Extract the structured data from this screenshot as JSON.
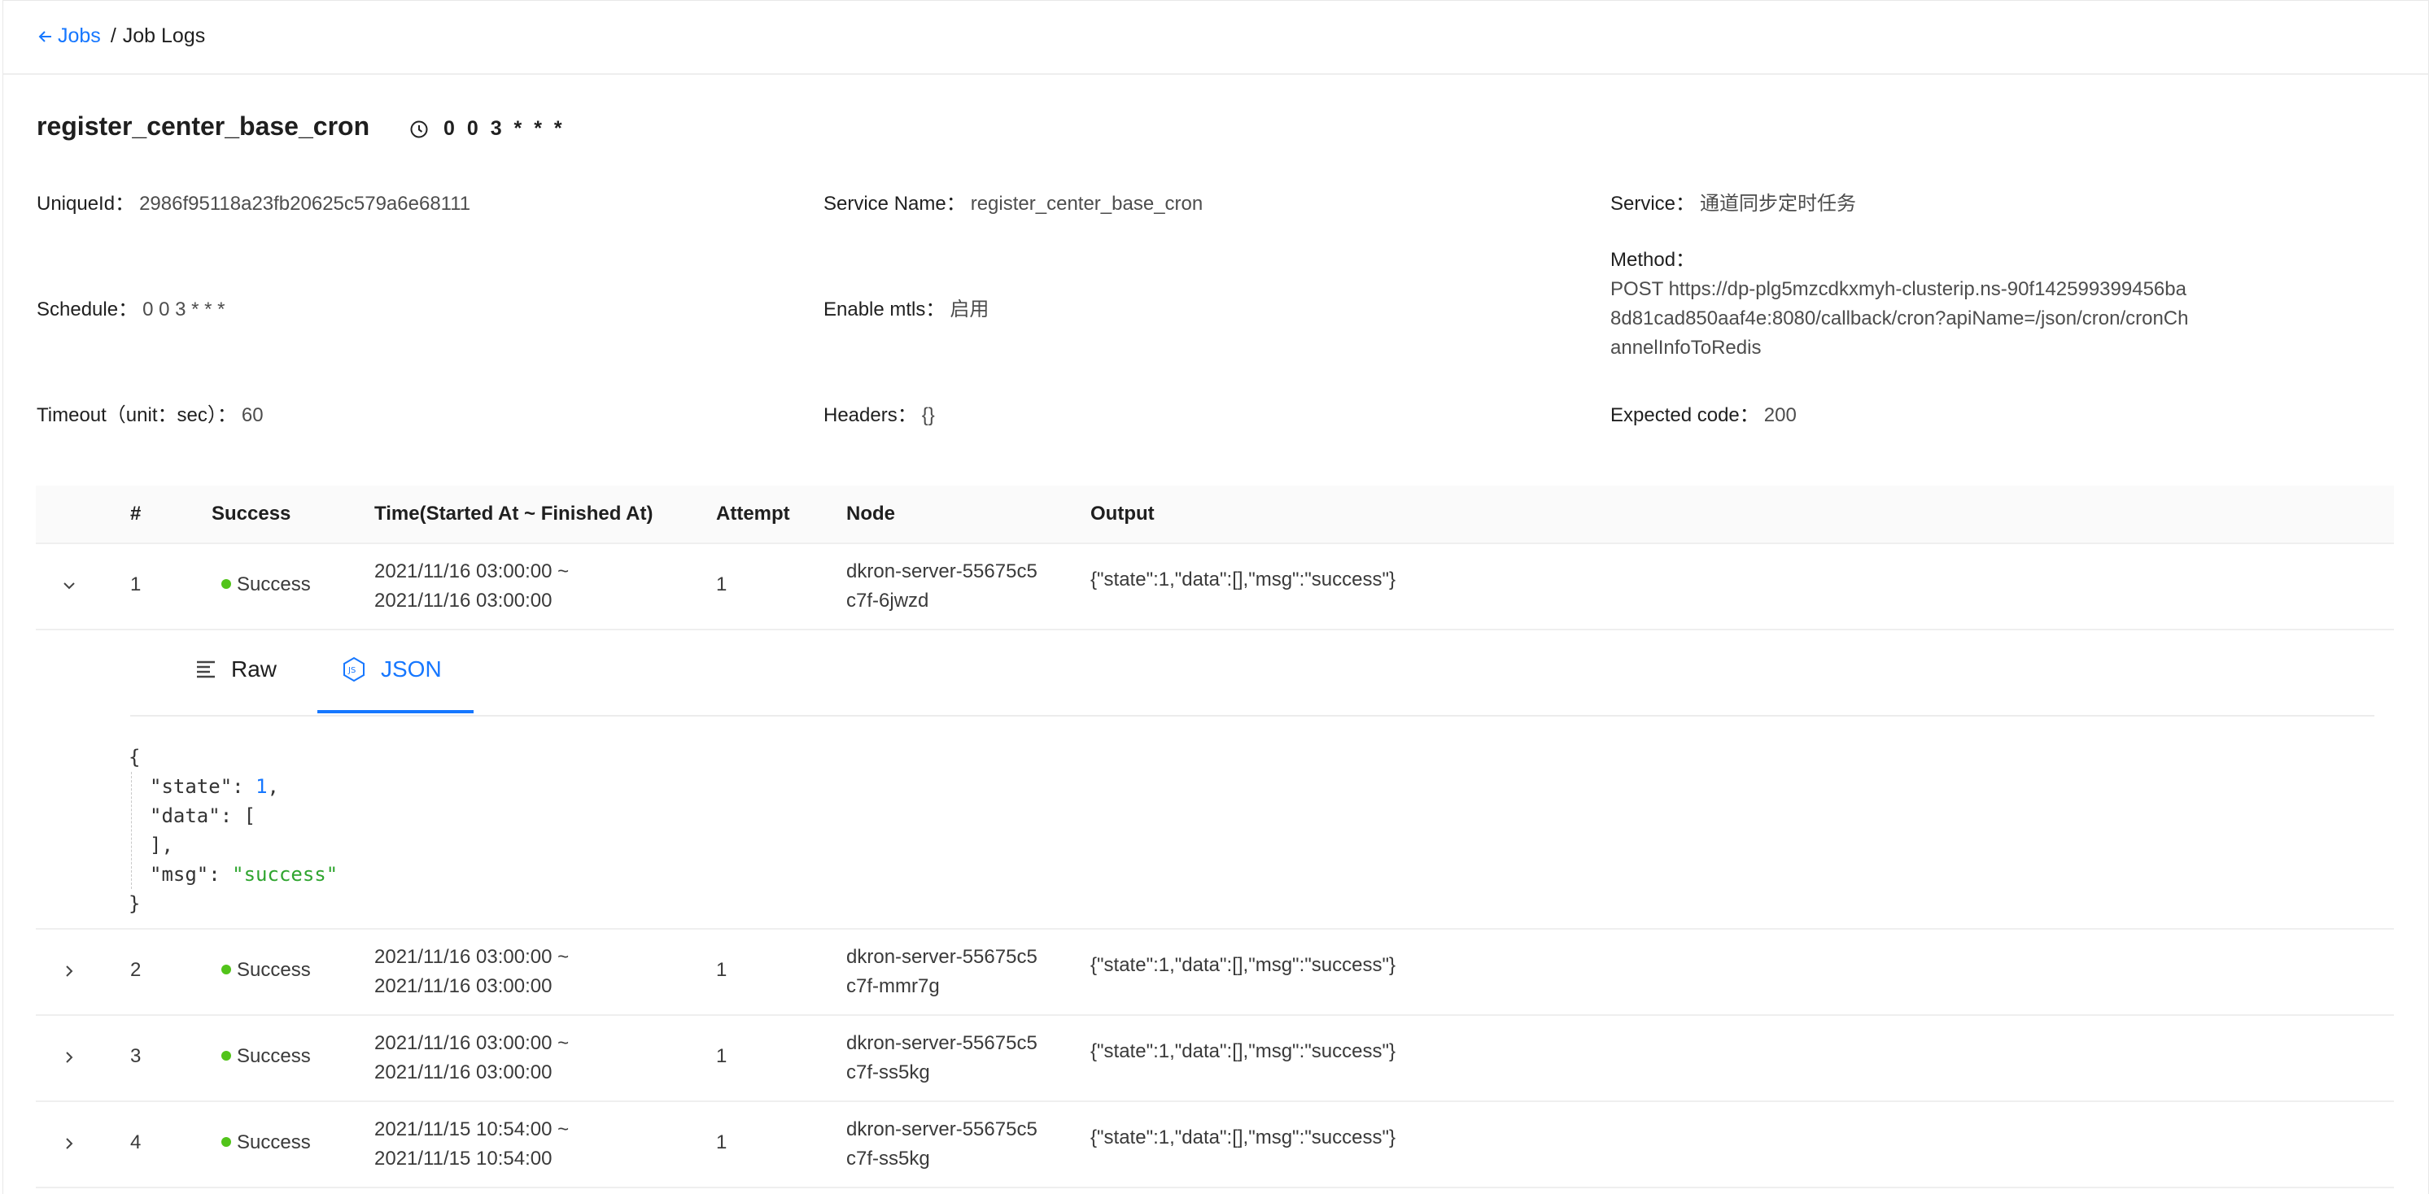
{
  "breadcrumb": {
    "back_label": "Jobs",
    "separator": "/",
    "current": "Job Logs"
  },
  "job": {
    "name": "register_center_base_cron",
    "schedule": "0 0 3 * * *"
  },
  "details": {
    "unique_id": {
      "label": "UniqueId：",
      "value": "2986f95118a23fb20625c579a6e68111"
    },
    "service_name": {
      "label": "Service Name：",
      "value": "register_center_base_cron"
    },
    "service": {
      "label": "Service：",
      "value": "通道同步定时任务"
    },
    "schedule": {
      "label": "Schedule：",
      "value": "0 0 3 * * *"
    },
    "enable_mtls": {
      "label": "Enable mtls：",
      "value": "启用"
    },
    "method": {
      "label": "Method：",
      "value": "POST https://dp-plg5mzcdkxmyh-clusterip.ns-90f142599399456ba8d81cad850aaf4e:8080/callback/cron?apiName=/json/cron/cronChannelInfoToRedis"
    },
    "timeout": {
      "label": "Timeout（unit：sec）：",
      "value": "60"
    },
    "headers": {
      "label": "Headers：",
      "value": "{}"
    },
    "expected_code": {
      "label": "Expected code：",
      "value": "200"
    }
  },
  "table": {
    "columns": [
      "#",
      "Success",
      "Time(Started At ~ Finished At)",
      "Attempt",
      "Node",
      "Output"
    ],
    "rows": [
      {
        "num": "1",
        "status": "Success",
        "time_start": "2021/11/16 03:00:00 ~",
        "time_end": "2021/11/16 03:00:00",
        "attempt": "1",
        "node_1": "dkron-server-55675c5",
        "node_2": "c7f-6jwzd",
        "output": "{\"state\":1,\"data\":[],\"msg\":\"success\"}"
      },
      {
        "num": "2",
        "status": "Success",
        "time_start": "2021/11/16 03:00:00 ~",
        "time_end": "2021/11/16 03:00:00",
        "attempt": "1",
        "node_1": "dkron-server-55675c5",
        "node_2": "c7f-mmr7g",
        "output": "{\"state\":1,\"data\":[],\"msg\":\"success\"}"
      },
      {
        "num": "3",
        "status": "Success",
        "time_start": "2021/11/16 03:00:00 ~",
        "time_end": "2021/11/16 03:00:00",
        "attempt": "1",
        "node_1": "dkron-server-55675c5",
        "node_2": "c7f-ss5kg",
        "output": "{\"state\":1,\"data\":[],\"msg\":\"success\"}"
      },
      {
        "num": "4",
        "status": "Success",
        "time_start": "2021/11/15 10:54:00 ~",
        "time_end": "2021/11/15 10:54:00",
        "attempt": "1",
        "node_1": "dkron-server-55675c5",
        "node_2": "c7f-ss5kg",
        "output": "{\"state\":1,\"data\":[],\"msg\":\"success\"}"
      }
    ]
  },
  "output_viewer": {
    "tabs": [
      {
        "label": "Raw",
        "icon": "lines-icon"
      },
      {
        "label": "JSON",
        "icon": "nodejs-icon"
      }
    ],
    "active_tab": "JSON",
    "json": {
      "open": "{",
      "close": "}",
      "state_key": "\"state\"",
      "state_val": "1",
      "data_key": "\"data\"",
      "data_open": "[",
      "data_close": "],",
      "msg_key": "\"msg\"",
      "msg_val": "\"success\""
    }
  },
  "colors": {
    "primary": "#1677ff",
    "success": "#52c41a",
    "string": "#2fa52f"
  }
}
